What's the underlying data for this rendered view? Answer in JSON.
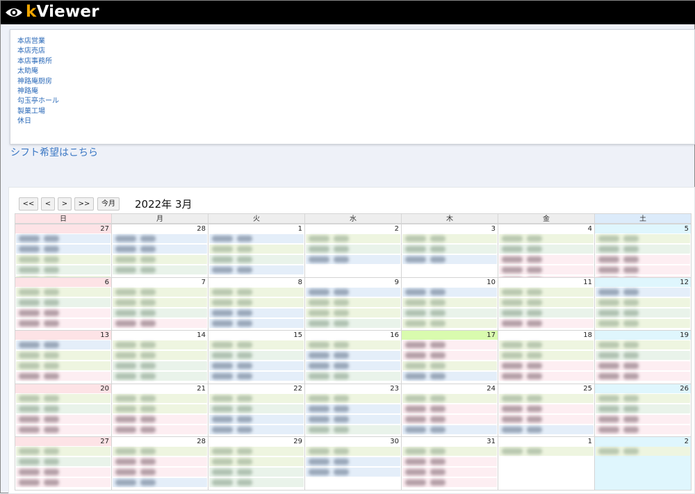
{
  "app": {
    "logo_k": "k",
    "logo_rest": "Viewer"
  },
  "links": [
    {
      "label": "本店営業"
    },
    {
      "label": "本店売店"
    },
    {
      "label": "本店事務所"
    },
    {
      "label": "太助庵"
    },
    {
      "label": "神路庵厨房"
    },
    {
      "label": "神路庵"
    },
    {
      "label": "勾玉亭ホール"
    },
    {
      "label": "製菓工場"
    },
    {
      "label": "休日"
    }
  ],
  "shift_link": "シフト希望はこちら",
  "calendar": {
    "nav": {
      "prev_year": "<<",
      "prev": "<",
      "next": ">",
      "next_year": ">>",
      "today": "今月"
    },
    "title": "2022年 3月",
    "weekdays": [
      "日",
      "月",
      "火",
      "水",
      "木",
      "金",
      "土"
    ],
    "colors": {
      "sunday_header": "#fde3e6",
      "saturday_header": "#dcebfa",
      "sunday_cell": "#fde3e6",
      "saturday_cell": "#dff6fd",
      "today_cell": "#d9fbae",
      "shift_green": "#eef5e0",
      "shift_blue": "#e4eef9",
      "shift_pink": "#fdeef2",
      "shift_mint": "#e9f3ea"
    },
    "weeks": [
      [
        {
          "day": "27",
          "other_month": true,
          "entries": [
            "blue",
            "blue",
            "green",
            "mint",
            "green"
          ]
        },
        {
          "day": "28",
          "other_month": true,
          "entries": [
            "blue",
            "blue",
            "green",
            "mint"
          ]
        },
        {
          "day": "1",
          "entries": [
            "blue",
            "green",
            "mint",
            "blue"
          ]
        },
        {
          "day": "2",
          "entries": [
            "green",
            "mint",
            "blue"
          ]
        },
        {
          "day": "3",
          "entries": [
            "green",
            "mint",
            "blue"
          ]
        },
        {
          "day": "4",
          "entries": [
            "green",
            "mint",
            "pink",
            "pink",
            "pink"
          ]
        },
        {
          "day": "5",
          "entries": [
            "green",
            "mint",
            "pink",
            "pink",
            "pink"
          ]
        }
      ],
      [
        {
          "day": "6",
          "entries": [
            "green",
            "mint",
            "pink",
            "pink"
          ]
        },
        {
          "day": "7",
          "entries": [
            "green",
            "green",
            "mint",
            "pink"
          ]
        },
        {
          "day": "8",
          "entries": [
            "green",
            "green",
            "blue",
            "blue"
          ]
        },
        {
          "day": "9",
          "entries": [
            "blue",
            "green",
            "green",
            "mint"
          ]
        },
        {
          "day": "10",
          "entries": [
            "blue",
            "green",
            "mint",
            "green"
          ]
        },
        {
          "day": "11",
          "entries": [
            "green",
            "green",
            "mint",
            "pink"
          ]
        },
        {
          "day": "12",
          "entries": [
            "blue",
            "green",
            "mint",
            "green"
          ]
        }
      ],
      [
        {
          "day": "13",
          "entries": [
            "blue",
            "green",
            "green",
            "pink"
          ]
        },
        {
          "day": "14",
          "entries": [
            "green",
            "green",
            "mint",
            "mint"
          ]
        },
        {
          "day": "15",
          "entries": [
            "green",
            "mint",
            "blue",
            "blue"
          ]
        },
        {
          "day": "16",
          "entries": [
            "green",
            "blue",
            "blue",
            "mint"
          ]
        },
        {
          "day": "17",
          "today": true,
          "entries": [
            "pink",
            "pink",
            "green",
            "blue"
          ]
        },
        {
          "day": "18",
          "entries": [
            "green",
            "green",
            "pink",
            "pink"
          ]
        },
        {
          "day": "19",
          "entries": [
            "green",
            "mint",
            "pink",
            "pink"
          ]
        }
      ],
      [
        {
          "day": "20",
          "entries": [
            "green",
            "mint",
            "pink",
            "pink"
          ]
        },
        {
          "day": "21",
          "entries": [
            "green",
            "green",
            "pink",
            "pink"
          ]
        },
        {
          "day": "22",
          "entries": [
            "green",
            "mint",
            "blue",
            "blue"
          ]
        },
        {
          "day": "23",
          "entries": [
            "green",
            "blue",
            "blue",
            "mint"
          ]
        },
        {
          "day": "24",
          "entries": [
            "green",
            "pink",
            "pink",
            "blue"
          ]
        },
        {
          "day": "25",
          "entries": [
            "green",
            "pink",
            "pink",
            "blue"
          ]
        },
        {
          "day": "26",
          "entries": [
            "green",
            "mint",
            "pink",
            "pink"
          ]
        }
      ],
      [
        {
          "day": "27",
          "entries": [
            "green",
            "mint",
            "pink",
            "pink"
          ]
        },
        {
          "day": "28",
          "entries": [
            "green",
            "pink",
            "pink",
            "blue"
          ]
        },
        {
          "day": "29",
          "entries": [
            "green",
            "green",
            "mint",
            "mint"
          ]
        },
        {
          "day": "30",
          "entries": [
            "green",
            "blue",
            "blue"
          ]
        },
        {
          "day": "31",
          "entries": [
            "green",
            "pink",
            "pink",
            "pink"
          ]
        },
        {
          "day": "1",
          "other_month": true,
          "entries": [
            "green"
          ]
        },
        {
          "day": "2",
          "other_month": true,
          "entries": [
            "green"
          ]
        }
      ]
    ]
  }
}
